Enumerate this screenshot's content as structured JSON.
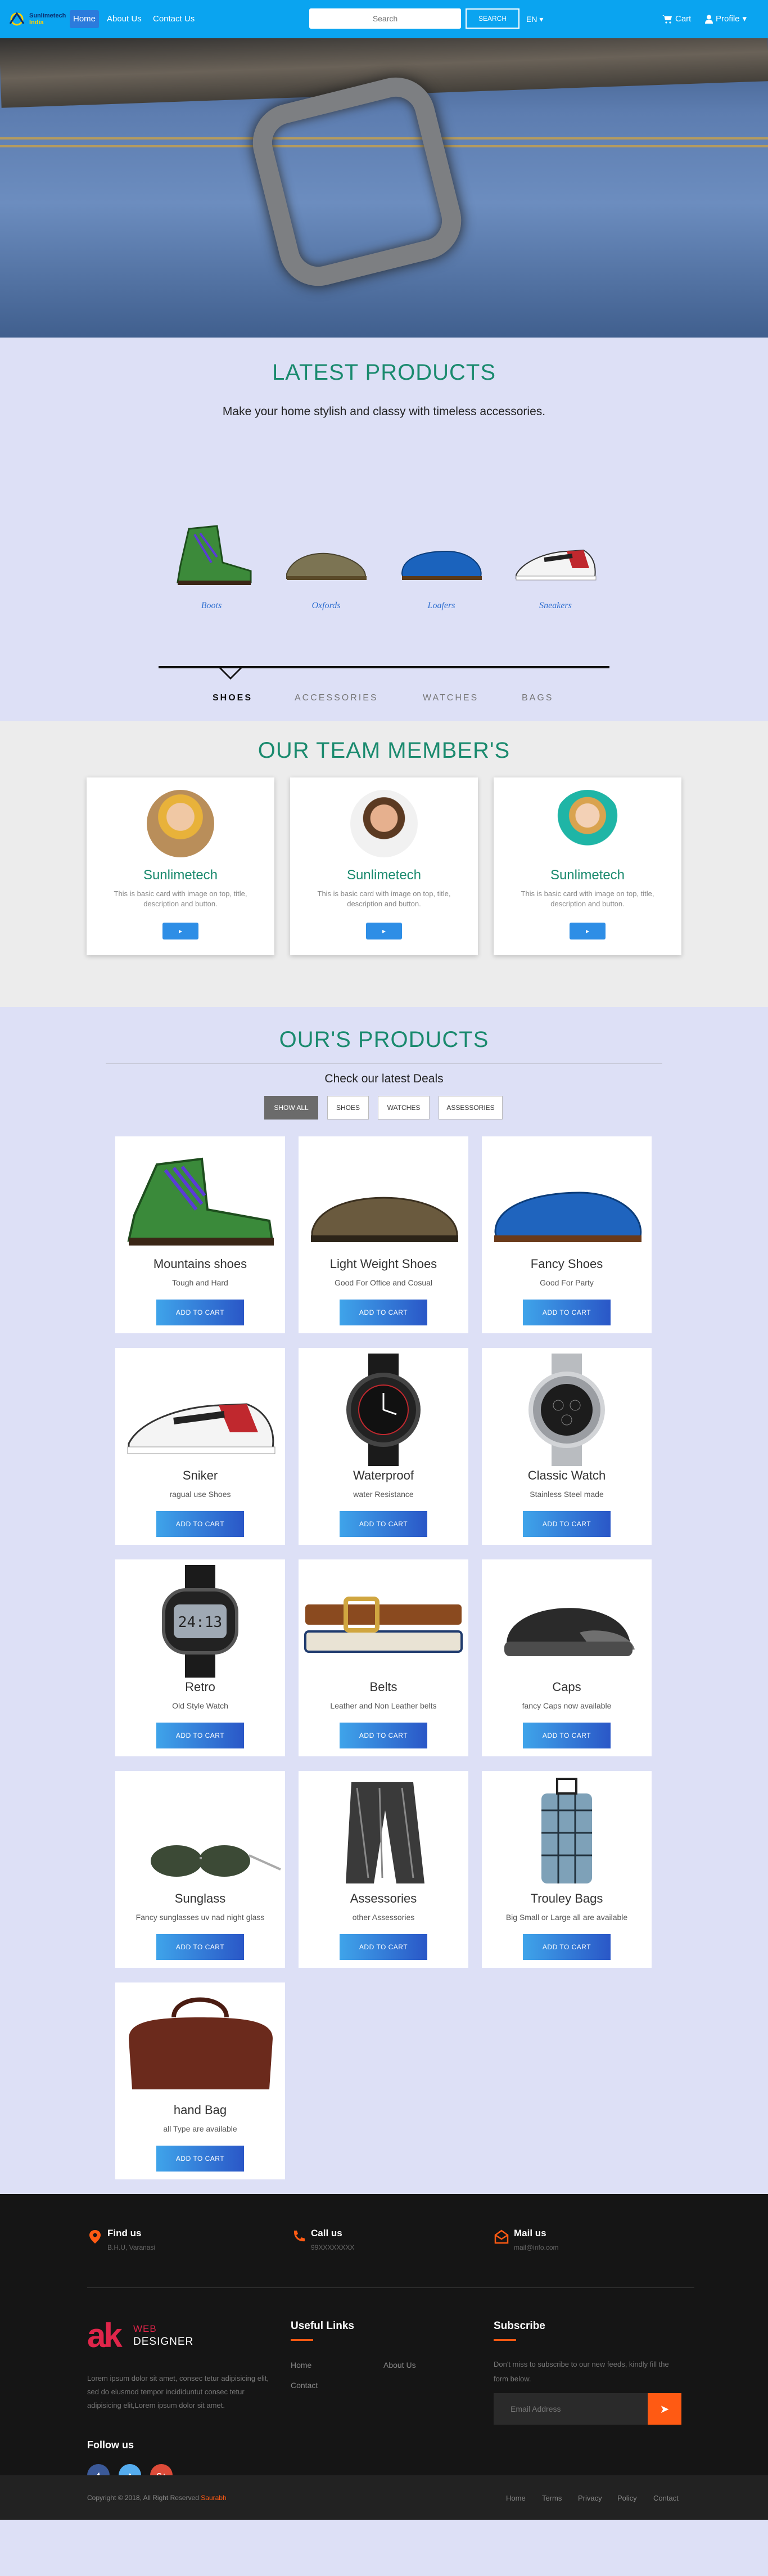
{
  "nav": {
    "logo_line1": "Sunlimetech",
    "logo_line2": "India",
    "links": [
      "Home",
      "About Us",
      "Contact Us"
    ],
    "search_placeholder": "Search",
    "search_button": "SEARCH",
    "language": "EN",
    "cart": "Cart",
    "profile": "Profile"
  },
  "latest": {
    "title": "LATEST PRODUCTS",
    "subtitle": "Make your home stylish and classy with timeless accessories.",
    "shoes": [
      "Boots",
      "Oxfords",
      "Loafers",
      "Sneakers"
    ],
    "tabs": [
      "SHOES",
      "ACCESSORIES",
      "WATCHES",
      "BAGS"
    ]
  },
  "team": {
    "title": "OUR TEAM MEMBER'S",
    "members": [
      {
        "name": "Sunlimetech",
        "desc": "This is basic card with image on top, title, description and button.",
        "button": "▸"
      },
      {
        "name": "Sunlimetech",
        "desc": "This is basic card with image on top, title, description and button.",
        "button": "▸"
      },
      {
        "name": "Sunlimetech",
        "desc": "This is basic card with image on top, title, description and button.",
        "button": "▸"
      }
    ]
  },
  "products": {
    "title": "OUR'S PRODUCTS",
    "subtitle": "Check our latest Deals",
    "filters": [
      "SHOW ALL",
      "SHOES",
      "WATCHES",
      "ASSESSORIES"
    ],
    "cart_label": "ADD TO CART",
    "items": [
      {
        "name": "Mountains shoes",
        "desc": "Tough and Hard"
      },
      {
        "name": "Light Weight Shoes",
        "desc": "Good For Office and Cosual"
      },
      {
        "name": "Fancy Shoes",
        "desc": "Good For Party"
      },
      {
        "name": "Sniker",
        "desc": "ragual use Shoes"
      },
      {
        "name": "Waterproof",
        "desc": "water Resistance"
      },
      {
        "name": "Classic Watch",
        "desc": "Stainless Steel made"
      },
      {
        "name": "Retro",
        "desc": "Old Style Watch"
      },
      {
        "name": "Belts",
        "desc": "Leather and Non Leather belts"
      },
      {
        "name": "Caps",
        "desc": "fancy Caps now available"
      },
      {
        "name": "Sunglass",
        "desc": "Fancy sunglasses uv nad night glass"
      },
      {
        "name": "Assessories",
        "desc": "other Assessories"
      },
      {
        "name": "Trouley Bags",
        "desc": "Big Small or Large all are available"
      },
      {
        "name": "hand Bag",
        "desc": "all Type are available"
      }
    ]
  },
  "footer": {
    "find_title": "Find us",
    "find_text": "B.H.U, Varanasi",
    "call_title": "Call us",
    "call_text": "99XXXXXXXX",
    "mail_title": "Mail us",
    "mail_text": "mail@info.com",
    "logo_ak": "ak",
    "logo_web": "WEB",
    "logo_designer": "DESIGNER",
    "lorem": "Lorem ipsum dolor sit amet, consec tetur adipisicing elit, sed do eiusmod tempor incididuntut consec tetur adipisicing elit,Lorem ipsum dolor sit amet.",
    "follow": "Follow us",
    "social": [
      "f",
      "t",
      "G+"
    ],
    "useful_title": "Useful Links",
    "useful_links": [
      "Home",
      "About Us",
      "Contact"
    ],
    "subscribe_title": "Subscribe",
    "subscribe_desc": "Don't miss to subscribe to our new feeds, kindly fill the form below.",
    "email_placeholder": "Email Address",
    "copyright_prefix": "Copyright © 2018, All Right Reserved ",
    "copyright_name": "Saurabh",
    "bottom_links": [
      "Home",
      "Terms",
      "Privacy",
      "Policy",
      "Contact"
    ],
    "colors": {
      "accent": "#ff5a13",
      "facebook": "#3b5998",
      "twitter": "#55acee",
      "google": "#dd4b39"
    }
  }
}
